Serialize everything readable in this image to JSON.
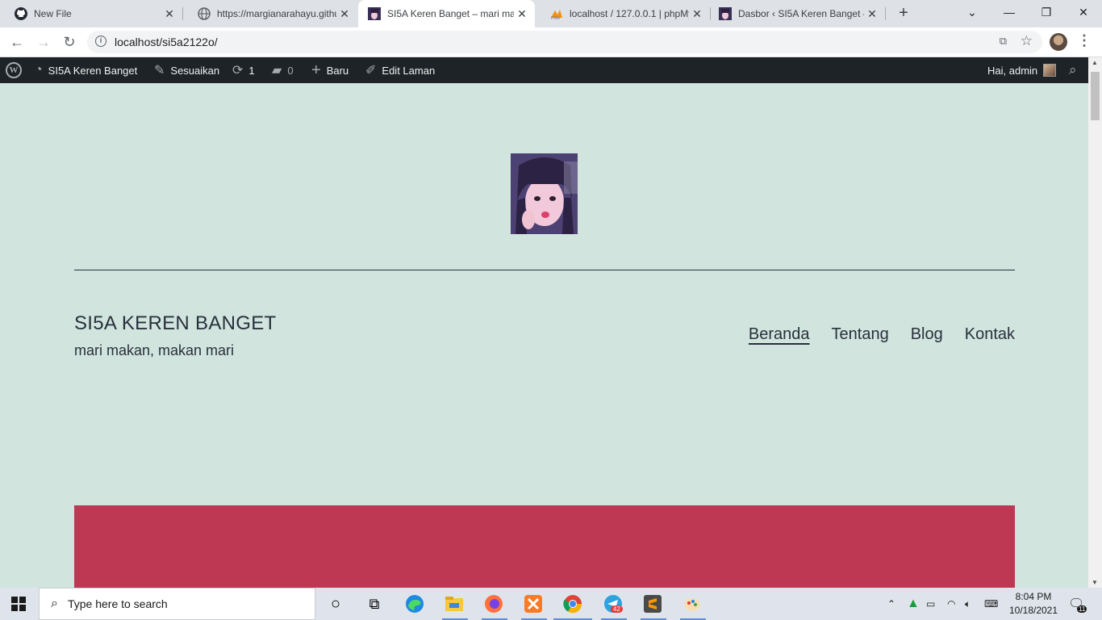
{
  "browser": {
    "tabs": [
      {
        "title": "New File",
        "icon": "github-icon"
      },
      {
        "title": "https://margianarahayu.githu",
        "icon": "globe-icon"
      },
      {
        "title": "SI5A Keren Banget – mari ma",
        "icon": "site-favicon",
        "active": true
      },
      {
        "title": "localhost / 127.0.0.1 | phpMy",
        "icon": "phpmyadmin-icon"
      },
      {
        "title": "Dasbor ‹ SI5A Keren Banget –",
        "icon": "site-favicon"
      }
    ],
    "url": "localhost/si5a2122o/"
  },
  "adminbar": {
    "site_name": "SI5A Keren Banget",
    "customize": "Sesuaikan",
    "updates_count": "1",
    "comments_count": "0",
    "new": "Baru",
    "edit_page": "Edit Laman",
    "greeting": "Hai, admin"
  },
  "site": {
    "title": "SI5A KEREN BANGET",
    "description": "mari makan, makan mari",
    "menu": [
      "Beranda",
      "Tentang",
      "Blog",
      "Kontak"
    ],
    "current_menu": "Beranda"
  },
  "colors": {
    "background": "#d1e4dd",
    "accent_block": "#be3854",
    "text": "#28303d",
    "adminbar": "#1d2327"
  },
  "taskbar": {
    "search_placeholder": "Type here to search",
    "time": "8:04 PM",
    "date": "10/18/2021",
    "telegram_badge": "42",
    "notification_count": "11"
  }
}
